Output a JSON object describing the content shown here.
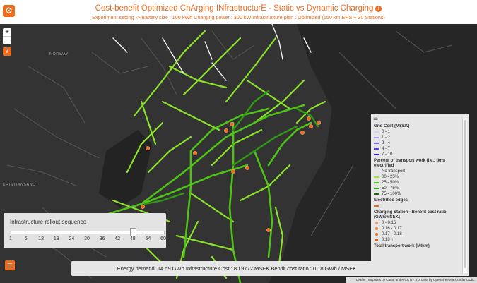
{
  "header": {
    "title": "Cost-benefit Optimized ChArging INfrastructurE - Static vs Dynamic Charging",
    "subtitle": "Experiment setting  -> Battery size : 100 kWh Charging power : 300 kW Infrastructure plan : Optimized (150 km ERS + 30 Stations)",
    "info_icon": "info-icon",
    "settings_icon": "gear-icon"
  },
  "map": {
    "country_labels": [
      "NORWAY",
      "KRISTIANSAND"
    ],
    "zoom_in": "+",
    "zoom_out": "−",
    "help": "?",
    "menu_icon": "menu-icon",
    "road_colors": {
      "none": "#5a5a5a",
      "p25": "#7bd61c",
      "p50": "#52c918",
      "p75": "#32a516",
      "p100": "#1d6f0e",
      "electrified": "#f06a1c"
    },
    "background_color": "#2b2b2b"
  },
  "rollout": {
    "label": "Infrastructure rollout sequence",
    "ticks": [
      "1",
      "6",
      "12",
      "18",
      "24",
      "30",
      "36",
      "42",
      "48",
      "54",
      "60"
    ],
    "selected_value": 48
  },
  "footer": {
    "text": "Energy demand: 14.59 GWh Infrastructure Cost : 80.9772 MSEK Benifit cost ratio : 0.18 GWh / MSEK"
  },
  "legend": {
    "grid_title": "Grid Cost (MSEK)",
    "grid_items": [
      {
        "label": "0 - 1",
        "color": "#d9d0f5"
      },
      {
        "label": "1 - 2",
        "color": "#a99bf0"
      },
      {
        "label": "2 - 4",
        "color": "#7d69ea"
      },
      {
        "label": "4 - 7",
        "color": "#5a3fe2"
      },
      {
        "label": "7 - 10",
        "color": "#3a1fc8"
      }
    ],
    "transport_title": "Percent of transport work (i.e., tkm) electrified",
    "transport_items": [
      {
        "label": "No transport",
        "color": ""
      },
      {
        "label": "00 - 25%",
        "color": "#9be33a"
      },
      {
        "label": "25 - 50%",
        "color": "#52c918"
      },
      {
        "label": "50 - 75%",
        "color": "#32a516"
      },
      {
        "label": "75 - 100%",
        "color": "#1d6f0e"
      }
    ],
    "electrified_title": "Electrified edges",
    "electrified_color": "#f06a1c",
    "station_title": "Charging Station - Benefit cost ratio (GWh/MSEK)",
    "station_items": [
      {
        "label": "0 - 0.16",
        "color": "#f6a36a"
      },
      {
        "label": "0.16 - 0.17",
        "color": "#f4893e"
      },
      {
        "label": "0.17 - 0.18",
        "color": "#f07420"
      },
      {
        "label": "0.18 +",
        "color": "#e55a05"
      }
    ],
    "total_title": "Total transport work (Mtkm)"
  },
  "attribution": "Leaflet | Map tiles by Carto, under CC BY 3.0. Data by OpenStreetMap, under ODbL."
}
